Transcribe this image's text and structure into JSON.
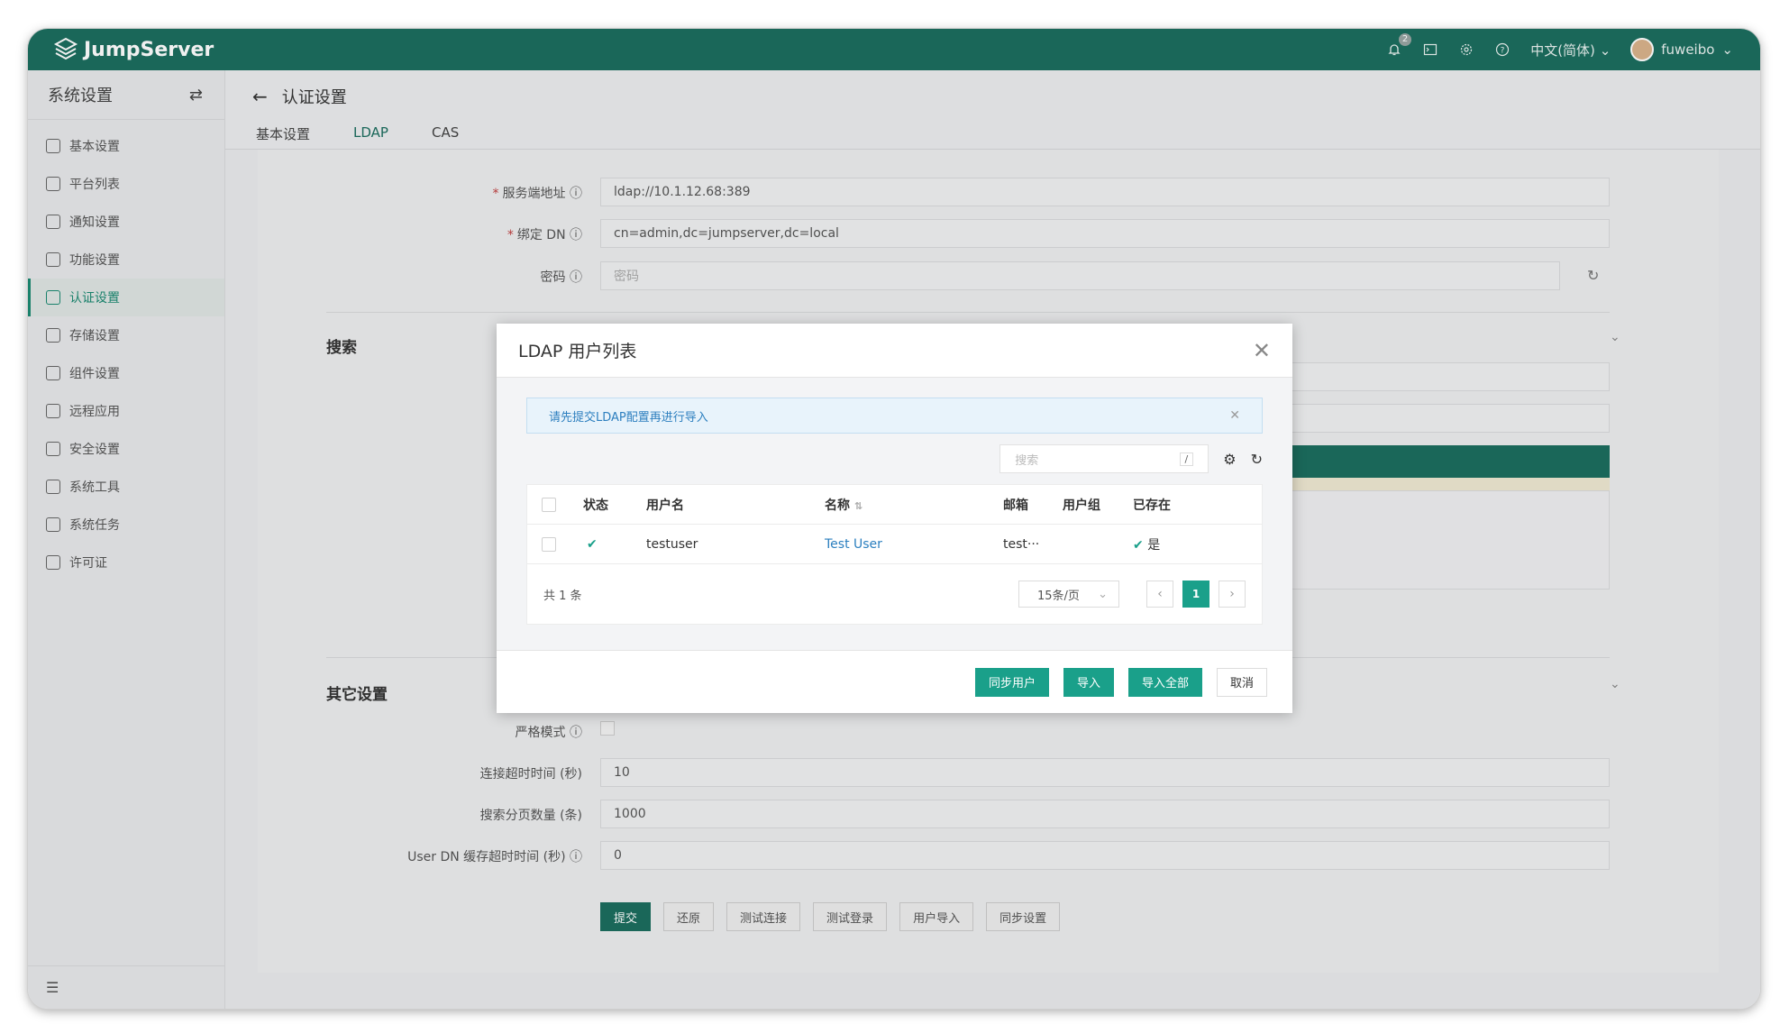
{
  "app": {
    "name": "JumpServer"
  },
  "topbar": {
    "notification_count": "2",
    "language": "中文(简体)",
    "username": "fuweibo"
  },
  "sidebar": {
    "title": "系统设置",
    "items": [
      {
        "label": "基本设置"
      },
      {
        "label": "平台列表"
      },
      {
        "label": "通知设置"
      },
      {
        "label": "功能设置"
      },
      {
        "label": "认证设置"
      },
      {
        "label": "存储设置"
      },
      {
        "label": "组件设置"
      },
      {
        "label": "远程应用"
      },
      {
        "label": "安全设置"
      },
      {
        "label": "系统工具"
      },
      {
        "label": "系统任务"
      },
      {
        "label": "许可证"
      }
    ],
    "active_index": 4
  },
  "page": {
    "title": "认证设置",
    "tabs": [
      {
        "label": "基本设置"
      },
      {
        "label": "LDAP"
      },
      {
        "label": "CAS"
      }
    ],
    "active_tab": "LDAP"
  },
  "form": {
    "server_label": "服务端地址",
    "server_value": "ldap://10.1.12.68:389",
    "bind_dn_label": "绑定 DN",
    "bind_dn_value": "cn=admin,dc=jumpserver,dc=local",
    "password_label": "密码",
    "password_placeholder": "密码",
    "search_section": "搜索",
    "other_section": "其它设置",
    "strict_label": "严格模式",
    "timeout_label": "连接超时时间 (秒)",
    "timeout_value": "10",
    "page_size_label": "搜索分页数量 (条)",
    "page_size_value": "1000",
    "cache_label": "User DN 缓存超时时间 (秒)",
    "cache_value": "0"
  },
  "actions": {
    "submit": "提交",
    "reset": "还原",
    "test_connection": "测试连接",
    "test_login": "测试登录",
    "user_import": "用户导入",
    "sync_settings": "同步设置"
  },
  "modal": {
    "title": "LDAP 用户列表",
    "alert": "请先提交LDAP配置再进行导入",
    "search_placeholder": "搜索",
    "search_hotkey": "/",
    "columns": {
      "status": "状态",
      "username": "用户名",
      "name": "名称",
      "email": "邮箱",
      "group": "用户组",
      "exists": "已存在"
    },
    "rows": [
      {
        "username": "testuser",
        "name": "Test User",
        "email": "test···",
        "group": "",
        "exists": "是"
      }
    ],
    "total": "共 1 条",
    "page_size": "15条/页",
    "current_page": "1",
    "buttons": {
      "sync": "同步用户",
      "import": "导入",
      "import_all": "导入全部",
      "cancel": "取消"
    }
  },
  "colors": {
    "brand": "#1c6e5f",
    "accent": "#1aa08a",
    "link": "#2b7fbf"
  }
}
